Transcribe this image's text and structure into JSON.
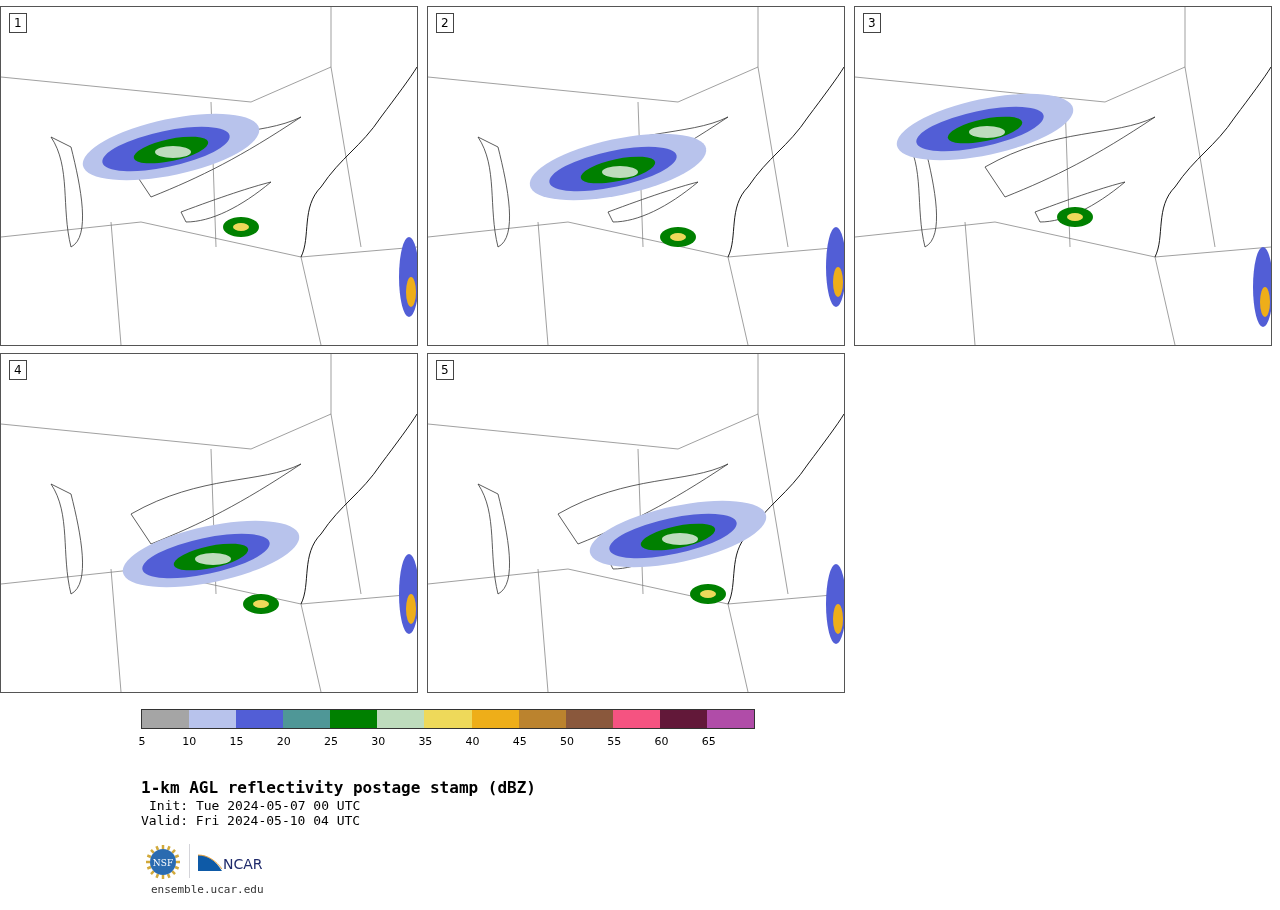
{
  "panels": [
    {
      "number": "1"
    },
    {
      "number": "2"
    },
    {
      "number": "3"
    },
    {
      "number": "4"
    },
    {
      "number": "5"
    }
  ],
  "colorbar": {
    "bins": [
      {
        "color": "#a5a5a5"
      },
      {
        "color": "#b8c3ec"
      },
      {
        "color": "#525ed6"
      },
      {
        "color": "#4f9797"
      },
      {
        "color": "#008000"
      },
      {
        "color": "#bedcbd"
      },
      {
        "color": "#eed95a"
      },
      {
        "color": "#eeae19"
      },
      {
        "color": "#bb832e"
      },
      {
        "color": "#8a583c"
      },
      {
        "color": "#f55381"
      },
      {
        "color": "#621839"
      },
      {
        "color": "#b04ca8"
      }
    ],
    "ticks": [
      "5",
      "10",
      "15",
      "20",
      "25",
      "30",
      "35",
      "40",
      "45",
      "50",
      "55",
      "60",
      "65"
    ]
  },
  "title": "1-km AGL reflectivity postage stamp (dBZ)",
  "init": "Init: Tue 2024-05-07 00 UTC",
  "valid": "Valid: Fri 2024-05-10 04 UTC",
  "logos": {
    "seal_text": "NSF",
    "wordmark": "NCAR"
  },
  "site": "ensemble.ucar.edu"
}
